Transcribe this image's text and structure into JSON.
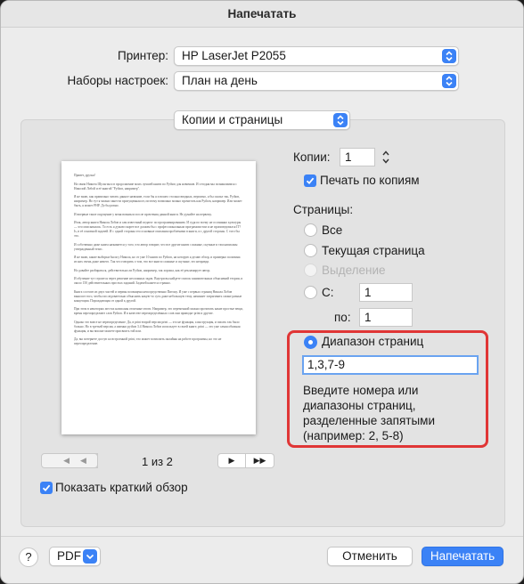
{
  "window": {
    "title": "Напечатать"
  },
  "printer": {
    "label": "Принтер:",
    "value": "HP LaserJet P2055"
  },
  "presets": {
    "label": "Наборы настроек:",
    "value": "План на день"
  },
  "section": {
    "value": "Копии и страницы"
  },
  "copies": {
    "label": "Копии:",
    "value": "1",
    "print_copies_label": "Печать по копиям",
    "print_copies_checked": true
  },
  "pages": {
    "label": "Страницы:",
    "all": "Все",
    "current": "Текущая страница",
    "selection": "Выделение",
    "from_label": "С:",
    "from_value": "1",
    "to_label": "по:",
    "to_value": "1",
    "range_label": "Диапазон страниц",
    "range_value": "1,3,7-9",
    "range_hint": "Введите номера или диапазоны страниц, разделенные запятыми (например: 2, 5-8)"
  },
  "preview": {
    "page_indicator": "1 из 2",
    "paragraphs": [
      "Привет, друзья!",
      "На связи Никита Шульгин и в продолжение моих лучшей книги по Python для новичков. И сегодня мы познакомимся с Николой Лобой и её книгой \"Python, например\".",
      "Я не знаю, как правильно читать данное название, если бы я и вошел столько вводных, вероятно, я бы сказал так, Python, например. Но тут я можно занести пропущенная ит, поэтому возможно можно прочитать как Python, например. Или может быть, я может PHP. До бы ровно.",
      "И впервые такое ощущение у меня возникло после прочтения данной книги. Не думайте на первому.",
      "Итак, автор книги Николя Лобов и сам известный педагог по программированию. И судя по всему не осознанно культуры — что описывалась. То есть я думаю скорее все должен бы с профессиональным программистом и не проповедовался IT?Is, в её основной задачей. И с одной стороны это основные описания проблемами в книги, и с другой стороны. С того бы это.",
      "И собственно даже книга называется у того, что автор говорит, что все другие книги сложные, скучные и там написаны утвержденный тезис.",
      "Я не знаю, какие выборки были у Никола, но от уже 10 книги по Python, на которую я делаю обзор, и примерно половина из них очень даже ничего. Так что говорить о том, что все книги сложные и скучные, это неправда.",
      "Но давайте разбираться, действительно ли Python, например, так хороша, как её рекламирует автор.",
      "И обучение тут строится через решение несложных задач. Внутри вы найдете список занимательных объяснений теории, и около 150 действительных простых заданий. Задачей кажется странно.",
      "Книга состоит из двух частей и первая посвящена непосредственно Питону. И уже с первых страниц Никола Лобов выносит того, чтобы последовательно объяснить какую-то суть даже небольшую тему, начинает затрагивать самые разные концепции. Порождающая от одной к другой.",
      "При этом в некоторых местах написаны отличные итоги. Например, это переменной можно прочитать какие простые вещи, время переопределяют слов Python. И в качестве переопределённых слов они приводят print и другие.",
      "Однако это вовсе не переопределение. Да, в print второй версии print — это не функция, а инструкция, и писать так было больно. Но в третьей версии, а именно python 3.4 Никола Лобов использует в своей книге, print — это уже самая обычная функция, и вы вполне можете присвоить той или.",
      "Да, вы потеряете доступ ко встроенной print, что может позволить онлайны на работе программы, но это не переопределение."
    ]
  },
  "show_summary": {
    "label": "Показать краткий обзор",
    "checked": true
  },
  "footer": {
    "help": "?",
    "pdf": "PDF",
    "cancel": "Отменить",
    "print": "Напечатать"
  },
  "colors": {
    "accent": "#3b82f6",
    "highlight": "#e03636"
  }
}
